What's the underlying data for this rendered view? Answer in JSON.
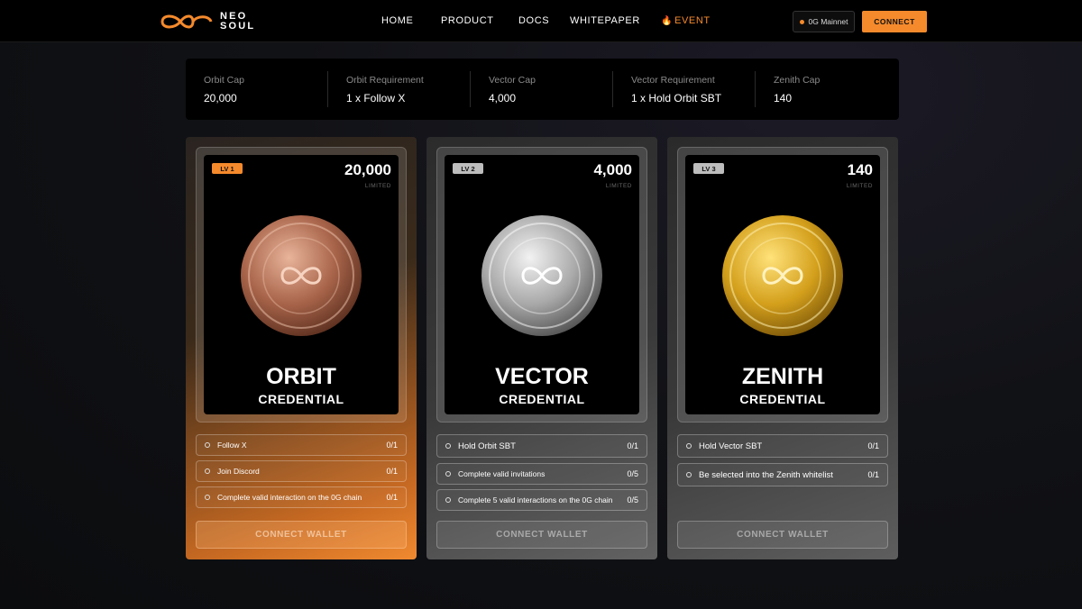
{
  "nav": {
    "logo_text_line1": "NEO",
    "logo_text_line2": "SOUL",
    "links": [
      "HOME",
      "PRODUCT",
      "DOCS",
      "WHITEPAPER",
      "EVENT"
    ],
    "network": "0G Mainnet",
    "connect_label": "CONNECT",
    "accent_color": "#f58a2c"
  },
  "stats": [
    {
      "label": "Orbit Cap",
      "value": "20,000"
    },
    {
      "label": "Orbit Requirement",
      "value": "1 x Follow X"
    },
    {
      "label": "Vector Cap",
      "value": "4,000"
    },
    {
      "label": "Vector Requirement",
      "value": "1 x Hold Orbit SBT"
    },
    {
      "label": "Zenith Cap",
      "value": "140"
    }
  ],
  "cards": [
    {
      "level": "LV 1",
      "limit": "20,000",
      "limit_label": "LIMITED",
      "title": "ORBIT",
      "subtitle": "CREDENTIAL",
      "coin_color": "bronze",
      "tasks": [
        {
          "name": "Follow X",
          "count": "0/1"
        },
        {
          "name": "Join Discord",
          "count": "0/1"
        },
        {
          "name": "Complete valid interaction on the 0G chain",
          "count": "0/1"
        }
      ],
      "button": "CONNECT WALLET"
    },
    {
      "level": "LV 2",
      "limit": "4,000",
      "limit_label": "LIMITED",
      "title": "VECTOR",
      "subtitle": "CREDENTIAL",
      "coin_color": "silver",
      "tasks": [
        {
          "name": "Hold Orbit SBT",
          "count": "0/1"
        },
        {
          "name": "Complete valid invitations",
          "count": "0/5"
        },
        {
          "name": "Complete 5 valid interactions on the 0G chain",
          "count": "0/5"
        }
      ],
      "button": "CONNECT WALLET"
    },
    {
      "level": "LV 3",
      "limit": "140",
      "limit_label": "LIMITED",
      "title": "ZENITH",
      "subtitle": "CREDENTIAL",
      "coin_color": "gold",
      "tasks": [
        {
          "name": "Hold Vector SBT",
          "count": "0/1"
        },
        {
          "name": "Be selected into the Zenith whitelist",
          "count": "0/1"
        }
      ],
      "button": "CONNECT WALLET"
    }
  ]
}
